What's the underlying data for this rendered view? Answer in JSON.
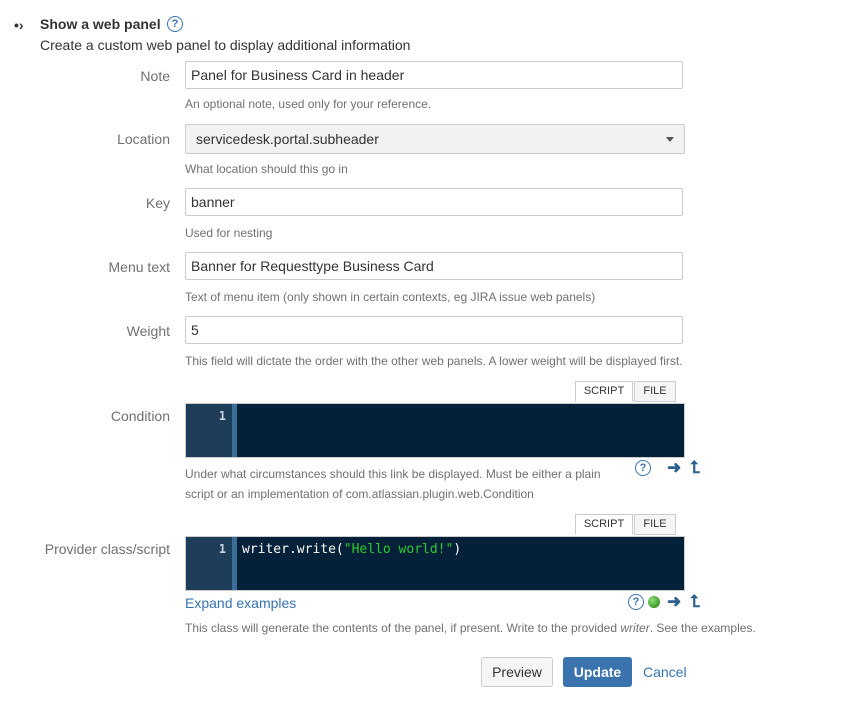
{
  "section": {
    "bullet": "•›",
    "title": "Show a web panel",
    "description": "Create a custom web panel to display additional information"
  },
  "fields": {
    "note": {
      "label": "Note",
      "value": "Panel for Business Card in header",
      "hint": "An optional note, used only for your reference."
    },
    "location": {
      "label": "Location",
      "value": "servicedesk.portal.subheader",
      "hint": "What location should this go in"
    },
    "key": {
      "label": "Key",
      "value": "banner",
      "hint": "Used for nesting"
    },
    "menu_text": {
      "label": "Menu text",
      "value": "Banner for Requesttype Business Card",
      "hint": "Text of menu item (only shown in certain contexts, eg JIRA issue web panels)"
    },
    "weight": {
      "label": "Weight",
      "value": "5",
      "hint": "This field will dictate the order with the other web panels. A lower weight will be displayed first."
    }
  },
  "condition": {
    "label": "Condition",
    "tab_script": "SCRIPT",
    "tab_file": "FILE",
    "line_number": "1",
    "code": "",
    "hint_line1": "Under what circumstances should this link be displayed. Must be either a plain",
    "hint_line2": "script or an implementation of com.atlassian.plugin.web.Condition"
  },
  "provider": {
    "label": "Provider class/script",
    "tab_script": "SCRIPT",
    "tab_file": "FILE",
    "line_number": "1",
    "code_prefix": "writer.write(",
    "code_string": "\"Hello world!\"",
    "code_suffix": ")",
    "expand_link": "Expand examples",
    "hint_before": "This class will generate the contents of the panel, if present. Write to the provided ",
    "hint_em": "writer",
    "hint_after": ". See the examples."
  },
  "icons": {
    "help": "?",
    "arrow_right": "➜",
    "arrow_up": "⮤"
  },
  "buttons": {
    "preview": "Preview",
    "update": "Update",
    "cancel": "Cancel"
  },
  "colors": {
    "accent": "#3b73af",
    "editor_bg": "#052039",
    "status_ok": "#3e9a27"
  }
}
